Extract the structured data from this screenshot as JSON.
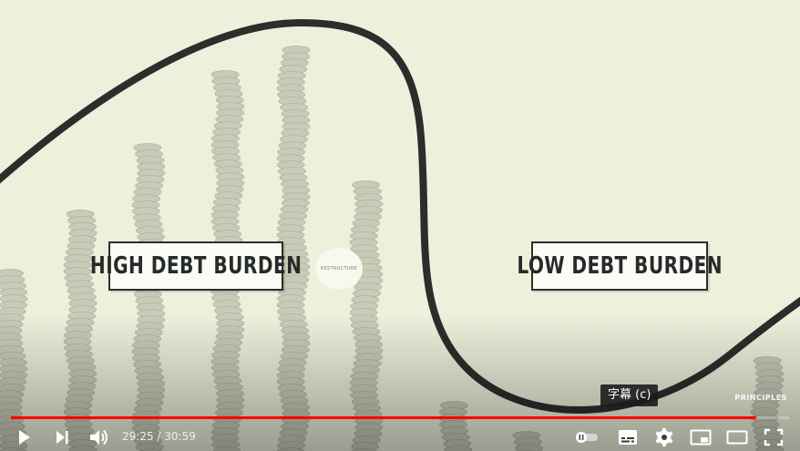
{
  "video": {
    "labels": {
      "high_debt": "HIGH DEBT BURDEN",
      "low_debt": "LOW DEBT BURDEN",
      "restructure": "RESTRUCTURE"
    },
    "brand": "PRINCIPLES",
    "colors": {
      "background": "#eef0dc",
      "curve": "#2a2f2c",
      "coin_stack": "#c9cbb9"
    }
  },
  "tooltip": {
    "text": "字幕 (c)"
  },
  "player": {
    "progress": 0.958,
    "progress_color": "#ff0000",
    "current_time": "29:25",
    "separator": " / ",
    "duration": "30:59",
    "icons": {
      "play": "play-icon",
      "next": "next-icon",
      "volume": "volume-icon",
      "autoplay": "autoplay-toggle-icon",
      "subtitles": "subtitles-icon",
      "settings": "gear-icon",
      "miniplayer": "miniplayer-icon",
      "theater": "theater-mode-icon",
      "fullscreen": "fullscreen-icon"
    }
  }
}
